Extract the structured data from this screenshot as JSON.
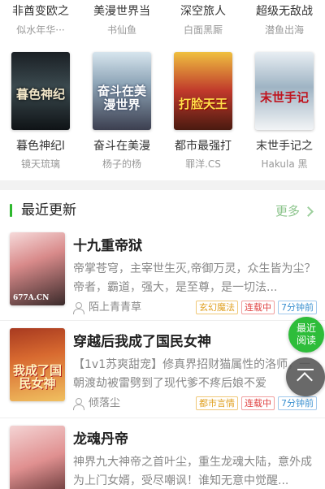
{
  "top_row": [
    {
      "title": "非酋变欧之",
      "author": "似水年华···"
    },
    {
      "title": "美漫世界当",
      "author": "书仙鱼"
    },
    {
      "title": "深空旅人",
      "author": "白面黑厮"
    },
    {
      "title": "超级无敌战",
      "author": "潜鱼出海"
    }
  ],
  "grid_row": [
    {
      "title": "暮色神纪l",
      "author": "镜天琉璃",
      "cover_text": "暮色神纪"
    },
    {
      "title": "奋斗在美漫",
      "author": "杨子的杨",
      "cover_text": "奋斗在美漫世界"
    },
    {
      "title": "都市最强打",
      "author": "罪洋.CS",
      "cover_text": "打脸天王"
    },
    {
      "title": "末世手记之",
      "author": "Hakula 黑",
      "cover_text": "末世手记"
    }
  ],
  "recent": {
    "title": "最近更新",
    "more": "更多",
    "items": [
      {
        "title": "十九重帝狱",
        "desc": "帝掌苍穹，主宰世生灭,帝御万灵，众生皆为尘？帝者，霸道，强大，是至尊，是一切法...",
        "author": "陌上青青草",
        "genre": "玄幻魔法",
        "status": "连载中",
        "time": "7分钟前",
        "thumb_text": "677A.CN"
      },
      {
        "title": "穿越后我成了国民女神",
        "desc": "【1v1苏爽甜宠】修真界招财猫属性的洛师，一朝渡劫被雷劈到了现代爹不疼后娘不爱",
        "author": "倾落尘",
        "genre": "都市言情",
        "status": "连载中",
        "time": "7分钟前",
        "thumb_text": "我成了国民女神"
      },
      {
        "title": "龙魂丹帝",
        "desc": "神界九大神帝之首叶尘，重生龙魂大陆，意外成为上门女婿，受尽嘲讽！谁知无意中觉醒...",
        "author": "",
        "genre": "",
        "status": "",
        "time": ""
      }
    ]
  },
  "fab": {
    "read_now": "最近阅读"
  },
  "colors": {
    "accent": "#2eb82e",
    "fab_green": "#2ebd3a",
    "genre": "#e0a020",
    "status": "#e04040",
    "time": "#3a90d0"
  }
}
